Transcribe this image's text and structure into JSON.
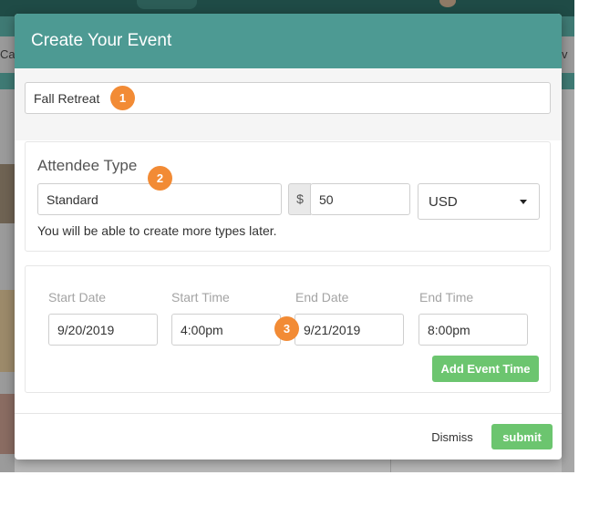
{
  "modal": {
    "title": "Create Your Event"
  },
  "event_name": {
    "value": "Fall Retreat"
  },
  "attendee": {
    "heading": "Attendee Type",
    "type_value": "Standard",
    "currency_symbol": "$",
    "price_value": "50",
    "currency_selected": "USD",
    "help_text": "You will be able to create more types later."
  },
  "event_time": {
    "labels": {
      "start_date": "Start Date",
      "start_time": "Start Time",
      "end_date": "End Date",
      "end_time": "End Time"
    },
    "values": {
      "start_date": "9/20/2019",
      "start_time": "4:00pm",
      "end_date": "9/21/2019",
      "end_time": "8:00pm"
    },
    "add_button": "Add Event Time"
  },
  "footer": {
    "dismiss": "Dismiss",
    "submit": "submit"
  },
  "badges": [
    "1",
    "2",
    "3"
  ],
  "background": {
    "left_tab_text": "Ca",
    "right_tab_text": "v E"
  },
  "colors": {
    "header": "#4d9a93",
    "button": "#6cc56f",
    "badge": "#f28b35"
  }
}
